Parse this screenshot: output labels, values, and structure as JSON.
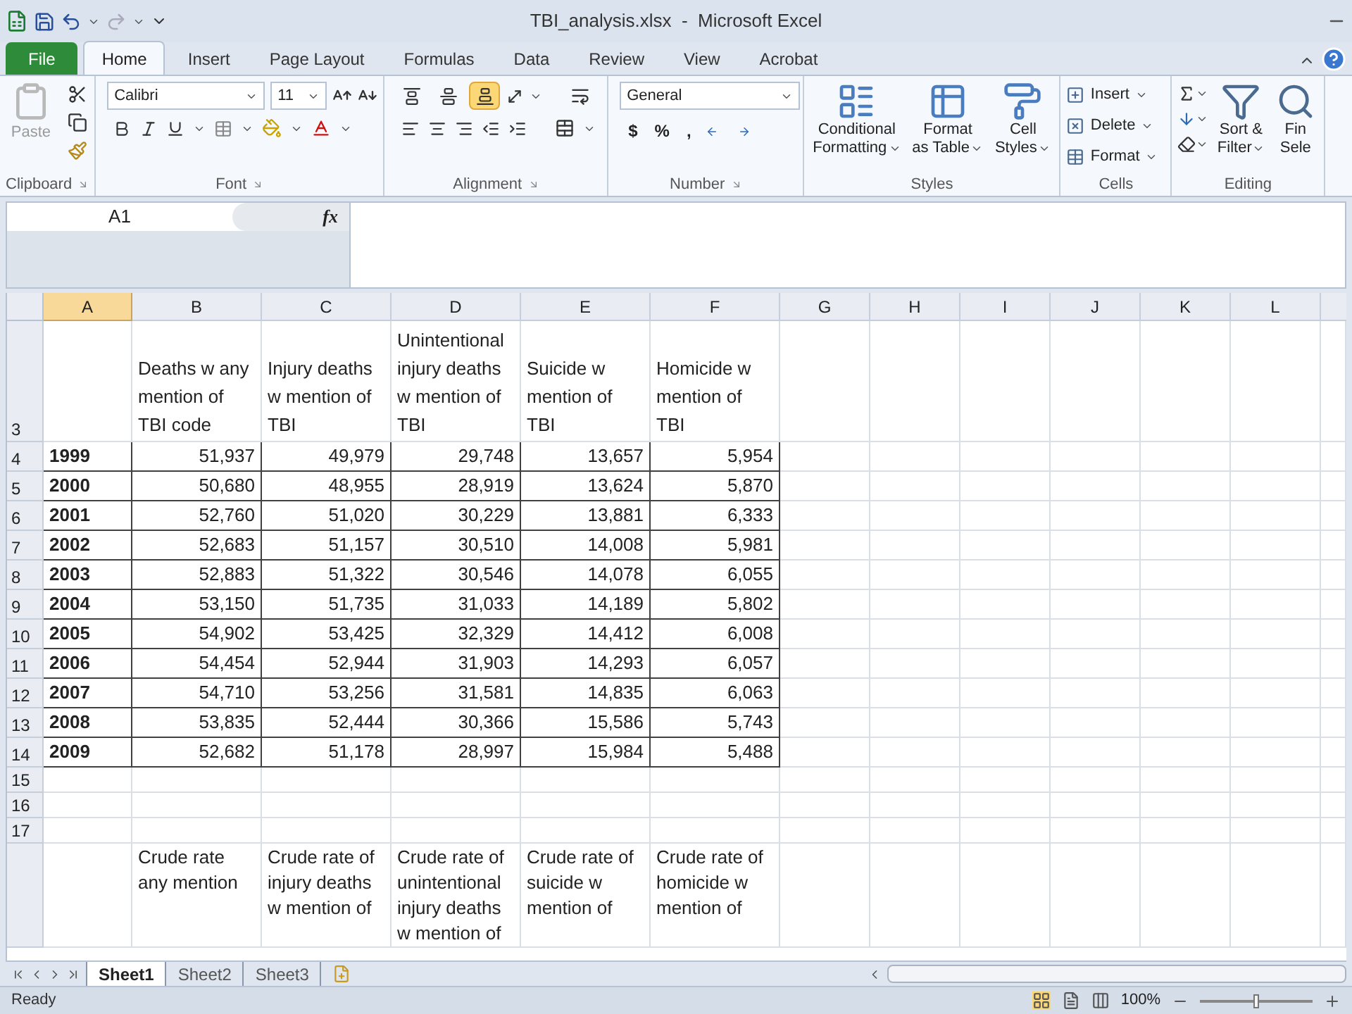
{
  "window": {
    "title": "TBI_analysis.xlsx  -  Microsoft Excel"
  },
  "file_tab": "File",
  "tabs": [
    {
      "label": "Home",
      "selected": true
    },
    {
      "label": "Insert",
      "selected": false
    },
    {
      "label": "Page Layout",
      "selected": false
    },
    {
      "label": "Formulas",
      "selected": false
    },
    {
      "label": "Data",
      "selected": false
    },
    {
      "label": "Review",
      "selected": false
    },
    {
      "label": "View",
      "selected": false
    },
    {
      "label": "Acrobat",
      "selected": false
    }
  ],
  "ribbon": {
    "clipboard": {
      "label": "Clipboard",
      "paste": "Paste",
      "paste_disabled": true
    },
    "font": {
      "label": "Font",
      "font_name": "Calibri",
      "font_size": "11"
    },
    "alignment": {
      "label": "Alignment",
      "vertical_align": [
        {
          "selected": false
        },
        {
          "selected": false
        },
        {
          "selected": true
        }
      ]
    },
    "number": {
      "label": "Number",
      "format": "General",
      "symbols": [
        "$",
        "%",
        ","
      ]
    },
    "styles": {
      "label": "Styles",
      "buttons": [
        {
          "lines": [
            "Conditional",
            "Formatting"
          ]
        },
        {
          "lines": [
            "Format",
            "as Table"
          ]
        },
        {
          "lines": [
            "Cell",
            "Styles"
          ]
        }
      ]
    },
    "cells": {
      "label": "Cells",
      "buttons": [
        "Insert",
        "Delete",
        "Format"
      ]
    },
    "editing": {
      "label": "Editing",
      "buttons": [
        {
          "lines": [
            "Sort &",
            "Filter"
          ]
        },
        {
          "lines": [
            "Fin",
            "Sele"
          ]
        }
      ]
    }
  },
  "formula_bar": {
    "name_box": "A1",
    "function_label": "fx"
  },
  "sheet": {
    "columns": [
      {
        "label": "A",
        "selected": true
      },
      {
        "label": "B",
        "selected": false
      },
      {
        "label": "C",
        "selected": false
      },
      {
        "label": "D",
        "selected": false
      },
      {
        "label": "E",
        "selected": false
      },
      {
        "label": "F",
        "selected": false
      },
      {
        "label": "G",
        "selected": false
      },
      {
        "label": "H",
        "selected": false
      },
      {
        "label": "I",
        "selected": false
      },
      {
        "label": "J",
        "selected": false
      },
      {
        "label": "K",
        "selected": false
      },
      {
        "label": "L",
        "selected": false
      }
    ],
    "rows": [
      {
        "number": "3",
        "kind": "header",
        "headings": [
          "Deaths w any mention of TBI code",
          "Injury deaths w mention of TBI",
          "Unintentional injury deaths w mention of TBI",
          "Suicide w mention of TBI",
          "Homicide w mention of TBI"
        ]
      },
      {
        "number": "4",
        "kind": "data",
        "year": "1999",
        "values": [
          "51,937",
          "49,979",
          "29,748",
          "13,657",
          "5,954"
        ]
      },
      {
        "number": "5",
        "kind": "data",
        "year": "2000",
        "values": [
          "50,680",
          "48,955",
          "28,919",
          "13,624",
          "5,870"
        ]
      },
      {
        "number": "6",
        "kind": "data",
        "year": "2001",
        "values": [
          "52,760",
          "51,020",
          "30,229",
          "13,881",
          "6,333"
        ]
      },
      {
        "number": "7",
        "kind": "data",
        "year": "2002",
        "values": [
          "52,683",
          "51,157",
          "30,510",
          "14,008",
          "5,981"
        ]
      },
      {
        "number": "8",
        "kind": "data",
        "year": "2003",
        "values": [
          "52,883",
          "51,322",
          "30,546",
          "14,078",
          "6,055"
        ]
      },
      {
        "number": "9",
        "kind": "data",
        "year": "2004",
        "values": [
          "53,150",
          "51,735",
          "31,033",
          "14,189",
          "5,802"
        ]
      },
      {
        "number": "10",
        "kind": "data",
        "year": "2005",
        "values": [
          "54,902",
          "53,425",
          "32,329",
          "14,412",
          "6,008"
        ]
      },
      {
        "number": "11",
        "kind": "data",
        "year": "2006",
        "values": [
          "54,454",
          "52,944",
          "31,903",
          "14,293",
          "6,057"
        ]
      },
      {
        "number": "12",
        "kind": "data",
        "year": "2007",
        "values": [
          "54,710",
          "53,256",
          "31,581",
          "14,835",
          "6,063"
        ]
      },
      {
        "number": "13",
        "kind": "data",
        "year": "2008",
        "values": [
          "53,835",
          "52,444",
          "30,366",
          "15,586",
          "5,743"
        ]
      },
      {
        "number": "14",
        "kind": "data",
        "year": "2009",
        "values": [
          "52,682",
          "51,178",
          "28,997",
          "15,984",
          "5,488"
        ]
      },
      {
        "number": "15",
        "kind": "empty"
      },
      {
        "number": "16",
        "kind": "empty"
      },
      {
        "number": "17",
        "kind": "empty"
      },
      {
        "kind": "header_cut",
        "headings": [
          "Crude rate any mention",
          "Crude rate of injury deaths w mention of",
          "Crude rate of unintentional injury deaths w mention of",
          "Crude rate of suicide w mention of",
          "Crude rate of homicide w mention of"
        ]
      }
    ]
  },
  "sheet_tabs": [
    {
      "label": "Sheet1",
      "selected": true
    },
    {
      "label": "Sheet2",
      "selected": false
    },
    {
      "label": "Sheet3",
      "selected": false
    }
  ],
  "status_bar": {
    "mode": "Ready",
    "zoom": "100%",
    "zoom_slider": {
      "level": 0.5
    }
  }
}
